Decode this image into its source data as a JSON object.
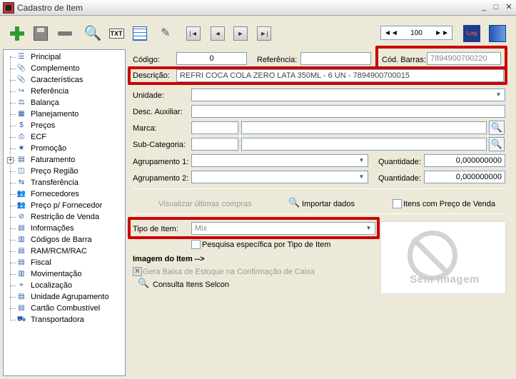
{
  "window": {
    "title": "Cadastro de Item"
  },
  "pager": {
    "value": "100",
    "first": "◄◄",
    "last": "►►"
  },
  "toolbar": {
    "txt_label": "TXT",
    "log_label": "Log"
  },
  "tree": {
    "items": [
      {
        "label": "Principal",
        "icon": "list-icon"
      },
      {
        "label": "Complemento",
        "icon": "clip-icon"
      },
      {
        "label": "Características",
        "icon": "clip-icon"
      },
      {
        "label": "Referência",
        "icon": "ref-icon"
      },
      {
        "label": "Balança",
        "icon": "scale-icon"
      },
      {
        "label": "Planejamento",
        "icon": "calendar-icon"
      },
      {
        "label": "Preços",
        "icon": "money-icon"
      },
      {
        "label": "ECF",
        "icon": "printer-icon"
      },
      {
        "label": "Promoção",
        "icon": "star-icon"
      },
      {
        "label": "Faturamento",
        "icon": "invoice-icon"
      },
      {
        "label": "Preço Região",
        "icon": "region-icon"
      },
      {
        "label": "Transferência",
        "icon": "transfer-icon"
      },
      {
        "label": "Fornecedores",
        "icon": "people-icon"
      },
      {
        "label": "Preço p/ Fornecedor",
        "icon": "people-icon"
      },
      {
        "label": "Restrição de Venda",
        "icon": "restriction-icon"
      },
      {
        "label": "Informações",
        "icon": "doc-icon"
      },
      {
        "label": "Códigos de Barra",
        "icon": "barcode-icon"
      },
      {
        "label": "RAM/RCM/RAC",
        "icon": "doc-icon"
      },
      {
        "label": "Fiscal",
        "icon": "doc-icon"
      },
      {
        "label": "Movimentação",
        "icon": "chart-icon"
      },
      {
        "label": "Localização",
        "icon": "location-icon"
      },
      {
        "label": "Unidade Agrupamento",
        "icon": "doc-icon"
      },
      {
        "label": "Cartão Combustível",
        "icon": "doc-icon"
      },
      {
        "label": "Transportadora",
        "icon": "truck-icon"
      }
    ]
  },
  "form": {
    "codigo_label": "Código:",
    "codigo_value": "0",
    "referencia_label": "Referência:",
    "referencia_value": "",
    "cod_barras_label": "Cód. Barras:",
    "cod_barras_value": "7894900700220",
    "descricao_label": "Descrição:",
    "descricao_value": "REFRI COCA COLA ZERO LATA 350ML - 6 UN - 7894900700015",
    "unidade_label": "Unidade:",
    "desc_auxiliar_label": "Desc. Auxiliar:",
    "marca_label": "Marca:",
    "subcategoria_label": "Sub-Categoria:",
    "agrupamento1_label": "Agrupamento 1:",
    "agrupamento2_label": "Agrupamento 2:",
    "quantidade_label": "Quantidade:",
    "quantidade1_value": "0,000000000",
    "quantidade2_value": "0,000000000",
    "visualizar_label": "Visualizar últimas compras",
    "importar_label": "Importar dados",
    "itens_preco_label": "Itens com Preço de Venda",
    "tipo_item_label": "Tipo de Item:",
    "tipo_item_value": "Mix",
    "pesquisa_label": "Pesquisa específica por Tipo de Item",
    "imagem_label": "Imagem do Item -->",
    "gera_baixa_label": "Gera Baixa de Estoque na Confirmação de Caixa",
    "consulta_label": "Consulta Itens Selcon",
    "sem_imagem": "Sem Imagem"
  },
  "colors": {
    "highlight": "#cc0000",
    "border": "#7f9db9",
    "background": "#ece9d8"
  }
}
